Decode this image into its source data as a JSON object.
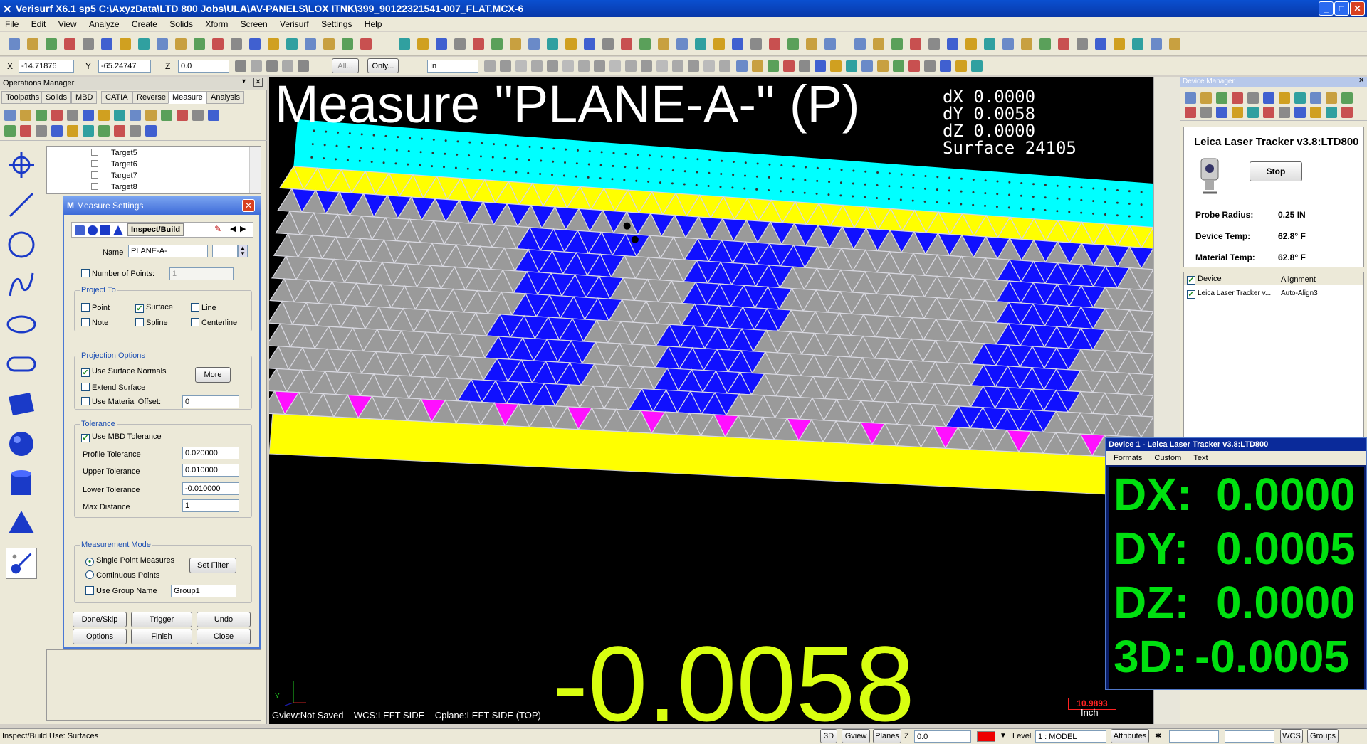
{
  "window": {
    "title": "Verisurf X6.1 sp5 C:\\AxyzData\\LTD 800 Jobs\\ULA\\AV-PANELS\\LOX ITNK\\399_90122321541-007_FLAT.MCX-6",
    "minimize": "_",
    "maximize": "□",
    "close": "✕"
  },
  "menu": [
    "File",
    "Edit",
    "View",
    "Analyze",
    "Create",
    "Solids",
    "Xform",
    "Screen",
    "Verisurf",
    "Settings",
    "Help"
  ],
  "coords": {
    "x_label": "X",
    "x_value": "-14.71876",
    "y_label": "Y",
    "y_value": "-65.24747",
    "z_label": "Z",
    "z_value": "0.0",
    "all_btn": "All...",
    "only_btn": "Only...",
    "units": "In"
  },
  "opmgr": {
    "title": "Operations Manager",
    "tabs": [
      "Toolpaths",
      "Solids",
      "MBD",
      "CATIA",
      "Reverse",
      "Measure",
      "Analysis"
    ],
    "active_tab": "Measure"
  },
  "tree": [
    "Target5",
    "Target6",
    "Target7",
    "Target8"
  ],
  "dialog": {
    "title": "Measure Settings",
    "mode_tab": "Inspect/Build",
    "name_label": "Name",
    "name_value": "PLANE-A-",
    "num_points_label": "Number of Points:",
    "num_points_value": "1",
    "project_to": {
      "title": "Project To",
      "point": "Point",
      "surface": "Surface",
      "line": "Line",
      "note": "Note",
      "spline": "Spline",
      "centerline": "Centerline"
    },
    "projection": {
      "title": "Projection Options",
      "use_normals": "Use Surface Normals",
      "more": "More",
      "extend": "Extend Surface",
      "material": "Use Material Offset:",
      "material_value": "0"
    },
    "tolerance": {
      "title": "Tolerance",
      "use_mbd": "Use MBD Tolerance",
      "profile": "Profile Tolerance",
      "profile_value": "0.020000",
      "upper": "Upper Tolerance",
      "upper_value": "0.010000",
      "lower": "Lower Tolerance",
      "lower_value": "-0.010000",
      "maxdist": "Max Distance",
      "maxdist_value": "1"
    },
    "mode": {
      "title": "Measurement Mode",
      "single": "Single Point Measures",
      "continuous": "Continuous Points",
      "filter": "Set Filter",
      "group": "Use Group Name",
      "group_value": "Group1"
    },
    "buttons": {
      "done": "Done/Skip",
      "trigger": "Trigger",
      "undo": "Undo",
      "options": "Options",
      "finish": "Finish",
      "close": "Close"
    }
  },
  "viewport": {
    "heading": "Measure \"PLANE-A-\" (P)",
    "dx": "dX 0.0000",
    "dy": "dY 0.0058",
    "dz": "dZ 0.0000",
    "surface": "Surface 24105",
    "big_value": "-0.0058",
    "status": "Gview:Not Saved    WCS:LEFT SIDE    Cplane:LEFT SIDE (TOP)",
    "scale_value": "10.9893",
    "scale_unit": "Inch",
    "axis_y": "Y"
  },
  "device_manager": {
    "title": "Device Manager",
    "device_name": "Leica Laser Tracker v3.8:LTD800",
    "stop": "Stop",
    "probe_label": "Probe Radius:",
    "probe_value": "0.25 IN",
    "temp_label": "Device Temp:",
    "temp_value": "62.8° F",
    "mat_label": "Material Temp:",
    "mat_value": "62.8° F",
    "col_device": "Device",
    "col_alignment": "Alignment",
    "row_device": "Leica Laser Tracker v...",
    "row_alignment": "Auto-Align3"
  },
  "readout": {
    "title": "Device 1 - Leica Laser Tracker v3.8:LTD800",
    "menu": [
      "Formats",
      "Custom",
      "Text"
    ],
    "dx_label": "DX:",
    "dx": "0.0000",
    "dy_label": "DY:",
    "dy": "0.0005",
    "dz_label": "DZ:",
    "dz": "0.0000",
    "d3_label": "3D:",
    "d3": "-0.0005"
  },
  "statusbar": {
    "left": "Inspect/Build Use: Surfaces",
    "btn_3d": "3D",
    "gview": "Gview",
    "planes": "Planes",
    "z_label": "Z",
    "z_value": "0.0",
    "level_label": "Level",
    "level_value": "1 : MODEL",
    "attributes": "Attributes",
    "wcs": "WCS",
    "groups": "Groups"
  },
  "colors": {
    "cyan": "#00ffff",
    "yellow": "#ffff00",
    "blue": "#1010ff",
    "gray": "#9a9a9a",
    "magenta": "#ff10ff",
    "readout_green": "#00e010",
    "big_value": "#d8ff10"
  }
}
